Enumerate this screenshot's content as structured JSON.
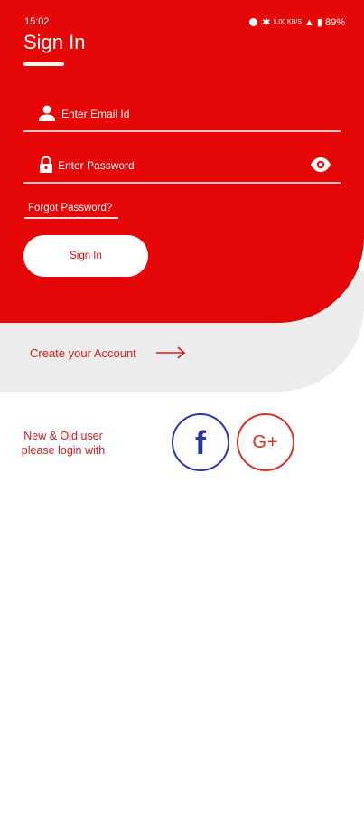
{
  "status_bar": {
    "time": "15:02",
    "icons": [
      "alarm-icon",
      "bluetooth-icon",
      "data-speed-icon",
      "signal-icon",
      "battery-icon"
    ],
    "data_speed": "5.00 KB/S",
    "battery": "89%"
  },
  "signin": {
    "title": "Sign In",
    "email_placeholder": "Enter Email Id",
    "password_placeholder": "Enter Password",
    "forgot_password": "Forgot Password?",
    "button_label": "Sign In"
  },
  "create_account": {
    "label": "Create your Account"
  },
  "social": {
    "prompt_line1": "New & Old user",
    "prompt_line2": "please login with",
    "facebook_glyph": "f",
    "google_glyph": "G+"
  },
  "colors": {
    "primary_red": "#e50607",
    "facebook_blue": "#2b35a6",
    "google_red": "#d93025",
    "background_grey": "#ececec"
  }
}
